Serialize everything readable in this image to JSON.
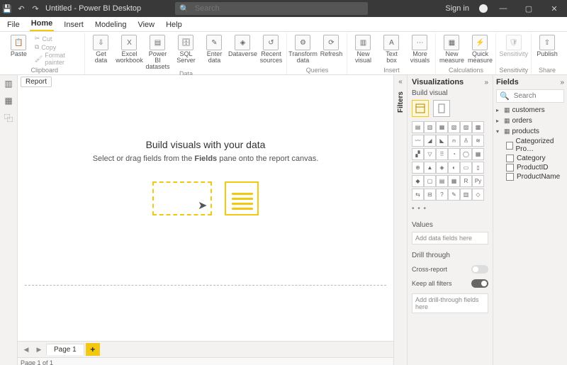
{
  "titlebar": {
    "title": "Untitled - Power BI Desktop",
    "search_placeholder": "Search",
    "signin": "Sign in"
  },
  "menu": {
    "tabs": [
      "File",
      "Home",
      "Insert",
      "Modeling",
      "View",
      "Help"
    ],
    "active": "Home"
  },
  "ribbon": {
    "clipboard": {
      "label": "Clipboard",
      "paste": "Paste",
      "cut": "Cut",
      "copy": "Copy",
      "format_painter": "Format painter"
    },
    "data": {
      "label": "Data",
      "get_data": "Get\ndata",
      "excel": "Excel\nworkbook",
      "pbi_ds": "Power BI\ndatasets",
      "sql": "SQL\nServer",
      "enter": "Enter\ndata",
      "dataverse": "Dataverse",
      "recent": "Recent\nsources"
    },
    "queries": {
      "label": "Queries",
      "transform": "Transform\ndata",
      "refresh": "Refresh"
    },
    "insert": {
      "label": "Insert",
      "new_visual": "New\nvisual",
      "text_box": "Text\nbox",
      "more": "More\nvisuals"
    },
    "calc": {
      "label": "Calculations",
      "new_measure": "New\nmeasure",
      "quick": "Quick\nmeasure"
    },
    "sens": {
      "label": "Sensitivity",
      "sensitivity": "Sensitivity"
    },
    "share": {
      "label": "Share",
      "publish": "Publish"
    }
  },
  "leftrail": {
    "report": "Report"
  },
  "canvas": {
    "report_chip": "Report",
    "heading": "Build visuals with your data",
    "sub_pre": "Select or drag fields from the ",
    "sub_bold": "Fields",
    "sub_post": " pane onto the report canvas."
  },
  "pagetabs": {
    "page1": "Page 1"
  },
  "status": {
    "text": "Page 1 of 1"
  },
  "filters_label": "Filters",
  "viz": {
    "title": "Visualizations",
    "build": "Build visual",
    "values": "Values",
    "values_placeholder": "Add data fields here",
    "drill": "Drill through",
    "cross": "Cross-report",
    "keep": "Keep all filters",
    "drill_placeholder": "Add drill-through fields here"
  },
  "fields": {
    "title": "Fields",
    "search_placeholder": "Search",
    "tables": [
      {
        "name": "customers",
        "expanded": false
      },
      {
        "name": "orders",
        "expanded": false
      },
      {
        "name": "products",
        "expanded": true,
        "cols": [
          "Categorized Pro…",
          "Category",
          "ProductID",
          "ProductName"
        ]
      }
    ]
  }
}
